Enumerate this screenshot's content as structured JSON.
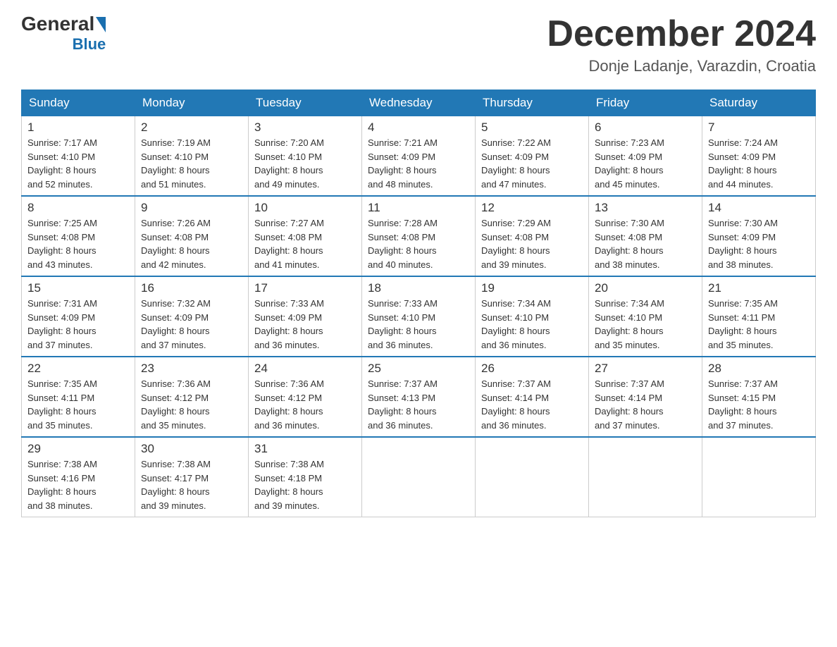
{
  "header": {
    "logo_general": "General",
    "logo_blue": "Blue",
    "main_title": "December 2024",
    "subtitle": "Donje Ladanje, Varazdin, Croatia"
  },
  "calendar": {
    "days_of_week": [
      "Sunday",
      "Monday",
      "Tuesday",
      "Wednesday",
      "Thursday",
      "Friday",
      "Saturday"
    ],
    "weeks": [
      [
        {
          "day": "1",
          "sunrise": "7:17 AM",
          "sunset": "4:10 PM",
          "daylight": "8 hours and 52 minutes."
        },
        {
          "day": "2",
          "sunrise": "7:19 AM",
          "sunset": "4:10 PM",
          "daylight": "8 hours and 51 minutes."
        },
        {
          "day": "3",
          "sunrise": "7:20 AM",
          "sunset": "4:10 PM",
          "daylight": "8 hours and 49 minutes."
        },
        {
          "day": "4",
          "sunrise": "7:21 AM",
          "sunset": "4:09 PM",
          "daylight": "8 hours and 48 minutes."
        },
        {
          "day": "5",
          "sunrise": "7:22 AM",
          "sunset": "4:09 PM",
          "daylight": "8 hours and 47 minutes."
        },
        {
          "day": "6",
          "sunrise": "7:23 AM",
          "sunset": "4:09 PM",
          "daylight": "8 hours and 45 minutes."
        },
        {
          "day": "7",
          "sunrise": "7:24 AM",
          "sunset": "4:09 PM",
          "daylight": "8 hours and 44 minutes."
        }
      ],
      [
        {
          "day": "8",
          "sunrise": "7:25 AM",
          "sunset": "4:08 PM",
          "daylight": "8 hours and 43 minutes."
        },
        {
          "day": "9",
          "sunrise": "7:26 AM",
          "sunset": "4:08 PM",
          "daylight": "8 hours and 42 minutes."
        },
        {
          "day": "10",
          "sunrise": "7:27 AM",
          "sunset": "4:08 PM",
          "daylight": "8 hours and 41 minutes."
        },
        {
          "day": "11",
          "sunrise": "7:28 AM",
          "sunset": "4:08 PM",
          "daylight": "8 hours and 40 minutes."
        },
        {
          "day": "12",
          "sunrise": "7:29 AM",
          "sunset": "4:08 PM",
          "daylight": "8 hours and 39 minutes."
        },
        {
          "day": "13",
          "sunrise": "7:30 AM",
          "sunset": "4:08 PM",
          "daylight": "8 hours and 38 minutes."
        },
        {
          "day": "14",
          "sunrise": "7:30 AM",
          "sunset": "4:09 PM",
          "daylight": "8 hours and 38 minutes."
        }
      ],
      [
        {
          "day": "15",
          "sunrise": "7:31 AM",
          "sunset": "4:09 PM",
          "daylight": "8 hours and 37 minutes."
        },
        {
          "day": "16",
          "sunrise": "7:32 AM",
          "sunset": "4:09 PM",
          "daylight": "8 hours and 37 minutes."
        },
        {
          "day": "17",
          "sunrise": "7:33 AM",
          "sunset": "4:09 PM",
          "daylight": "8 hours and 36 minutes."
        },
        {
          "day": "18",
          "sunrise": "7:33 AM",
          "sunset": "4:10 PM",
          "daylight": "8 hours and 36 minutes."
        },
        {
          "day": "19",
          "sunrise": "7:34 AM",
          "sunset": "4:10 PM",
          "daylight": "8 hours and 36 minutes."
        },
        {
          "day": "20",
          "sunrise": "7:34 AM",
          "sunset": "4:10 PM",
          "daylight": "8 hours and 35 minutes."
        },
        {
          "day": "21",
          "sunrise": "7:35 AM",
          "sunset": "4:11 PM",
          "daylight": "8 hours and 35 minutes."
        }
      ],
      [
        {
          "day": "22",
          "sunrise": "7:35 AM",
          "sunset": "4:11 PM",
          "daylight": "8 hours and 35 minutes."
        },
        {
          "day": "23",
          "sunrise": "7:36 AM",
          "sunset": "4:12 PM",
          "daylight": "8 hours and 35 minutes."
        },
        {
          "day": "24",
          "sunrise": "7:36 AM",
          "sunset": "4:12 PM",
          "daylight": "8 hours and 36 minutes."
        },
        {
          "day": "25",
          "sunrise": "7:37 AM",
          "sunset": "4:13 PM",
          "daylight": "8 hours and 36 minutes."
        },
        {
          "day": "26",
          "sunrise": "7:37 AM",
          "sunset": "4:14 PM",
          "daylight": "8 hours and 36 minutes."
        },
        {
          "day": "27",
          "sunrise": "7:37 AM",
          "sunset": "4:14 PM",
          "daylight": "8 hours and 37 minutes."
        },
        {
          "day": "28",
          "sunrise": "7:37 AM",
          "sunset": "4:15 PM",
          "daylight": "8 hours and 37 minutes."
        }
      ],
      [
        {
          "day": "29",
          "sunrise": "7:38 AM",
          "sunset": "4:16 PM",
          "daylight": "8 hours and 38 minutes."
        },
        {
          "day": "30",
          "sunrise": "7:38 AM",
          "sunset": "4:17 PM",
          "daylight": "8 hours and 39 minutes."
        },
        {
          "day": "31",
          "sunrise": "7:38 AM",
          "sunset": "4:18 PM",
          "daylight": "8 hours and 39 minutes."
        },
        null,
        null,
        null,
        null
      ]
    ]
  },
  "labels": {
    "sunrise_label": "Sunrise:",
    "sunset_label": "Sunset:",
    "daylight_label": "Daylight:"
  }
}
